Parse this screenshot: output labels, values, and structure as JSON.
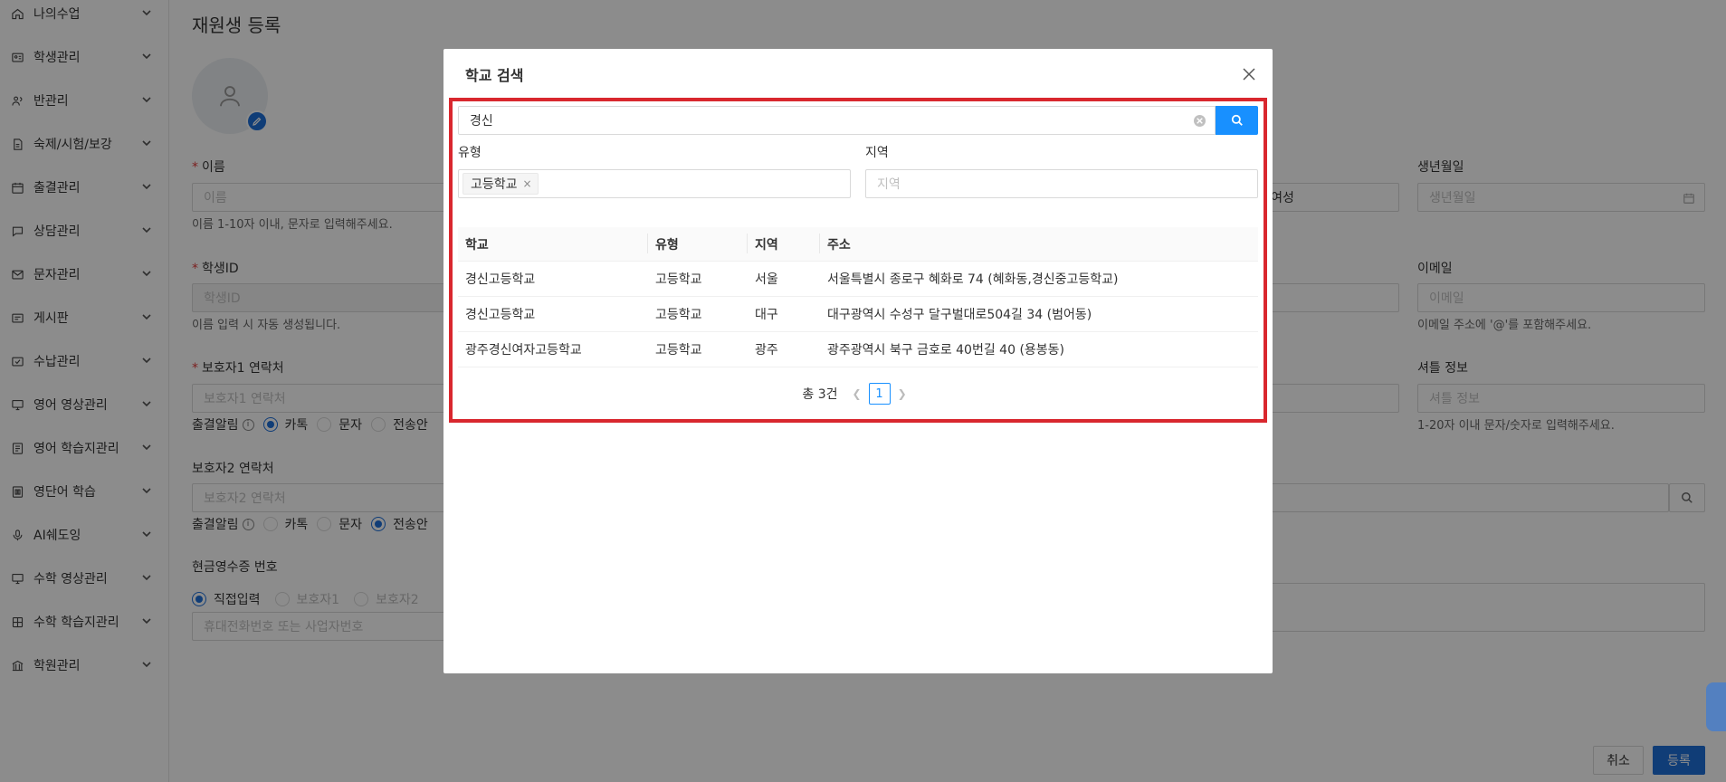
{
  "sidebar": {
    "items": [
      {
        "label": "나의수업",
        "icon": "home-icon"
      },
      {
        "label": "학생관리",
        "icon": "id-card-icon"
      },
      {
        "label": "반관리",
        "icon": "users-icon"
      },
      {
        "label": "숙제/시험/보강",
        "icon": "document-icon"
      },
      {
        "label": "출결관리",
        "icon": "calendar-icon"
      },
      {
        "label": "상담관리",
        "icon": "chat-icon"
      },
      {
        "label": "문자관리",
        "icon": "mail-icon"
      },
      {
        "label": "게시판",
        "icon": "board-icon"
      },
      {
        "label": "수납관리",
        "icon": "payment-icon"
      },
      {
        "label": "영어 영상관리",
        "icon": "monitor-icon"
      },
      {
        "label": "영어 학습지관리",
        "icon": "workbook-icon"
      },
      {
        "label": "영단어 학습",
        "icon": "vocab-icon"
      },
      {
        "label": "AI쉐도잉",
        "icon": "microphone-icon"
      },
      {
        "label": "수학 영상관리",
        "icon": "monitor-icon"
      },
      {
        "label": "수학 학습지관리",
        "icon": "grid-icon"
      },
      {
        "label": "학원관리",
        "icon": "building-icon"
      }
    ]
  },
  "page": {
    "title": "재원생 등록",
    "name_label": "이름",
    "name_placeholder": "이름",
    "name_help": "이름 1-10자 이내, 문자로 입력해주세요.",
    "student_id_label": "학생ID",
    "student_id_placeholder": "학생ID",
    "student_id_help": "이름 입력 시 자동 생성됩니다.",
    "guardian1_label": "보호자1 연락처",
    "guardian1_placeholder": "보호자1 연락처",
    "guardian2_label": "보호자2 연락처",
    "guardian2_placeholder": "보호자2 연락처",
    "attend_label": "출결알림",
    "opt_kakao": "카톡",
    "opt_sms": "문자",
    "opt_none": "전송안",
    "receipt_label": "현금영수증 번호",
    "receipt_opt_direct": "직접입력",
    "receipt_opt_g1": "보호자1",
    "receipt_opt_g2": "보호자2",
    "receipt_placeholder": "휴대전화번호 또는 사업자번호",
    "gender_female": "여성",
    "birth_label": "생년월일",
    "birth_placeholder": "생년월일",
    "email_label": "이메일",
    "email_placeholder": "이메일",
    "email_help": "이메일 주소에 '@'를 포함해주세요.",
    "shuttle_label": "셔틀 정보",
    "shuttle_placeholder": "셔틀 정보",
    "shuttle_help": "1-20자 이내 문자/숫자로 입력해주세요.",
    "cancel_button": "취소",
    "submit_button": "등록"
  },
  "modal": {
    "title": "학교 검색",
    "search_value": "경신",
    "type_label": "유형",
    "type_tag": "고등학교",
    "region_label": "지역",
    "region_placeholder": "지역",
    "columns": [
      "학교",
      "유형",
      "지역",
      "주소"
    ],
    "rows": [
      [
        "경신고등학교",
        "고등학교",
        "서울",
        "서울특별시 종로구 혜화로 74 (혜화동,경신중고등학교)"
      ],
      [
        "경신고등학교",
        "고등학교",
        "대구",
        "대구광역시 수성구 달구벌대로504길 34 (범어동)"
      ],
      [
        "광주경신여자고등학교",
        "고등학교",
        "광주",
        "광주광역시 북구 금호로 40번길 40 (용봉동)"
      ]
    ],
    "total_text": "총 3건",
    "current_page": "1"
  },
  "colors": {
    "primary": "#1890ff",
    "highlight_border": "#d9272e",
    "submit_bg": "#1e6fd9"
  }
}
